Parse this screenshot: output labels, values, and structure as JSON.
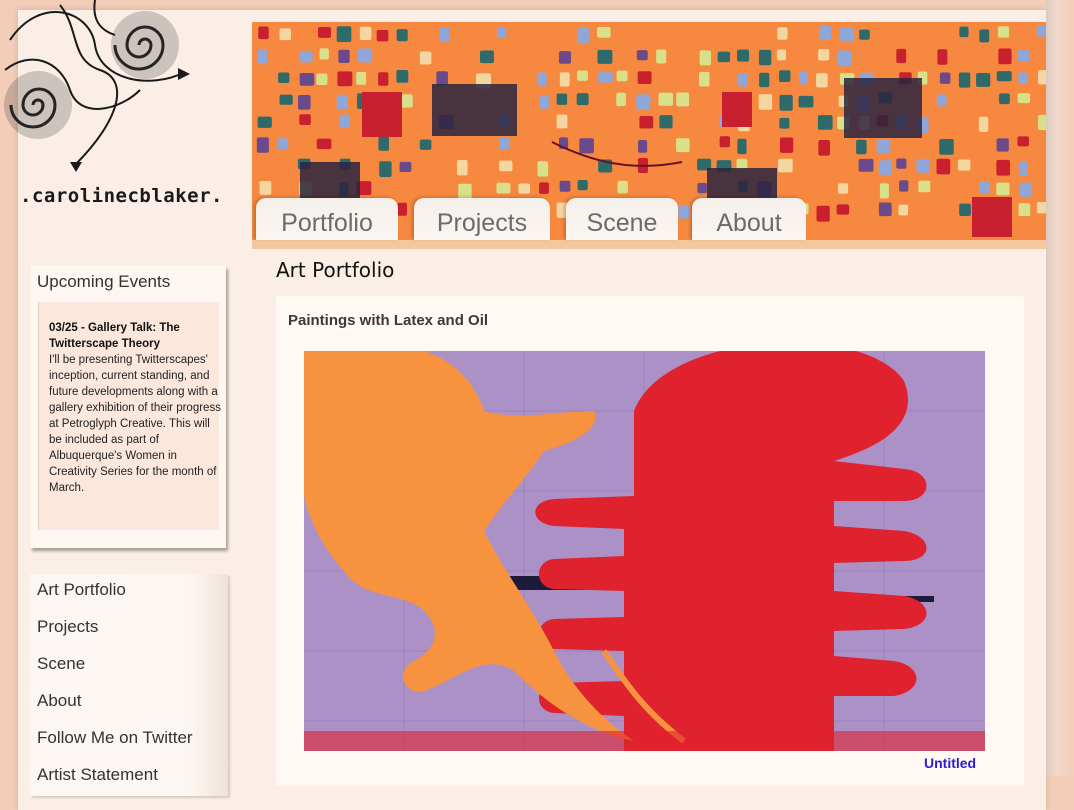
{
  "site": {
    "brand": ".carolinecblaker."
  },
  "tabs": [
    {
      "label": "Portfolio"
    },
    {
      "label": "Projects"
    },
    {
      "label": "Scene"
    },
    {
      "label": "About"
    }
  ],
  "main": {
    "title": "Art Portfolio",
    "section_title": "Paintings with Latex and Oil",
    "caption": "Untitled"
  },
  "events": {
    "heading": "Upcoming Events",
    "item_title": "03/25 - Gallery Talk: The Twitterscape Theory",
    "item_text": "I'll be presenting Twitterscapes' inception, current standing, and future developments along with a gallery exhibition of their progress at Petroglyph Creative. This will be included as part of Albuquerque's Women in Creativity Series for the month of March."
  },
  "nav": [
    {
      "label": "Art Portfolio"
    },
    {
      "label": "Projects"
    },
    {
      "label": "Scene"
    },
    {
      "label": "About"
    },
    {
      "label": "Follow Me on Twitter"
    },
    {
      "label": "Artist Statement"
    }
  ],
  "colors": {
    "background": "#f3cdb8",
    "link": "#2a1bd6",
    "banner": "#f7883f"
  }
}
